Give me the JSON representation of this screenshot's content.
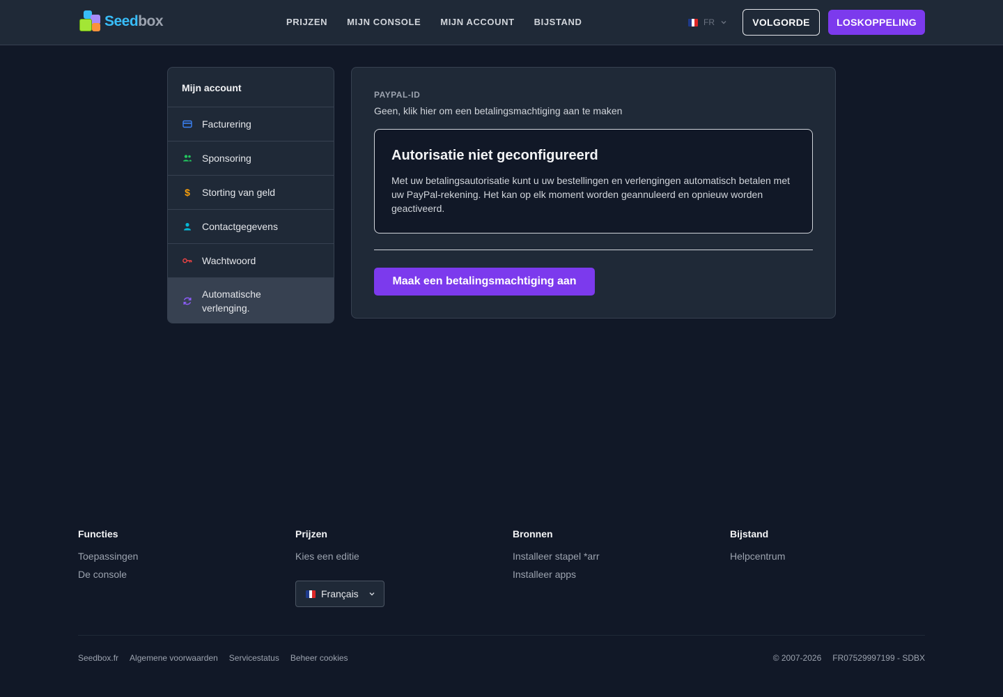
{
  "header": {
    "logo_text_a": "Seed",
    "logo_text_b": "box",
    "nav": [
      "PRIJZEN",
      "MIJN CONSOLE",
      "MIJN ACCOUNT",
      "BIJSTAND"
    ],
    "lang": "FR",
    "btn_outline": "VOLGORDE",
    "btn_primary": "LOSKOPPELING"
  },
  "sidebar": {
    "title": "Mijn account",
    "items": [
      {
        "label": "Facturering",
        "icon": "credit-card-icon",
        "color": "#3b82f6"
      },
      {
        "label": "Sponsoring",
        "icon": "users-icon",
        "color": "#22c55e"
      },
      {
        "label": "Storting van geld",
        "icon": "dollar-icon",
        "color": "#f59e0b"
      },
      {
        "label": "Contactgegevens",
        "icon": "user-icon",
        "color": "#06b6d4"
      },
      {
        "label": "Wachtwoord",
        "icon": "key-icon",
        "color": "#ef4444"
      },
      {
        "label": "Automatische verlenging.",
        "icon": "refresh-icon",
        "color": "#8b5cf6"
      }
    ]
  },
  "main": {
    "paypal_label": "PAYPAL-ID",
    "paypal_text": "Geen, klik hier om een betalingsmachtiging aan te maken",
    "notice_title": "Autorisatie niet geconfigureerd",
    "notice_text": "Met uw betalingsautorisatie kunt u uw bestellingen en verlengingen automatisch betalen met uw PayPal-rekening. Het kan op elk moment worden geannuleerd en opnieuw worden geactiveerd.",
    "create_button": "Maak een betalingsmachtiging aan"
  },
  "footer": {
    "columns": [
      {
        "title": "Functies",
        "links": [
          "Toepassingen",
          "De console"
        ]
      },
      {
        "title": "Prijzen",
        "links": [
          "Kies een editie"
        ]
      },
      {
        "title": "Bronnen",
        "links": [
          "Installeer stapel *arr",
          "Installeer apps"
        ]
      },
      {
        "title": "Bijstand",
        "links": [
          "Helpcentrum"
        ]
      }
    ],
    "language": "Français",
    "bottom_links": [
      "Seedbox.fr",
      "Algemene voorwaarden",
      "Servicestatus",
      "Beheer cookies"
    ],
    "copyright": "© 2007-2026",
    "company_id": "FR07529997199 - SDBX"
  },
  "colors": {
    "accent": "#7c3aed",
    "background": "#111827",
    "surface": "#1f2937"
  }
}
